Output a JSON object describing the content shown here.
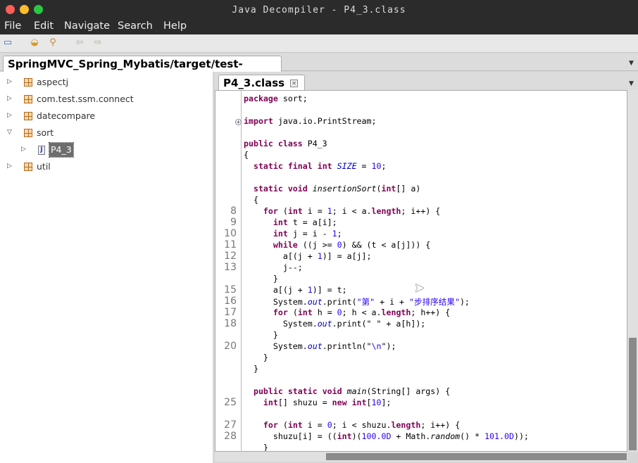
{
  "window": {
    "title": "Java Decompiler - P4_3.class"
  },
  "menu": [
    "File",
    "Edit",
    "Navigate",
    "Search",
    "Help"
  ],
  "toolbar": [
    {
      "icon": "open-file-icon"
    },
    {
      "icon": "open-type-icon"
    },
    {
      "icon": "search-icon"
    },
    {
      "icon": "back-arrow-icon"
    },
    {
      "icon": "forward-arrow-icon"
    }
  ],
  "outer_tab": {
    "label": "SpringMVC_Spring_Mybatis/target/test-classes"
  },
  "tree": [
    {
      "label": "aspectj",
      "expanded": false,
      "type": "package"
    },
    {
      "label": "com.test.ssm.connect",
      "expanded": false,
      "type": "package"
    },
    {
      "label": "datecompare",
      "expanded": false,
      "type": "package"
    },
    {
      "label": "sort",
      "expanded": true,
      "type": "package"
    },
    {
      "label": "P4_3",
      "expanded": false,
      "type": "class",
      "selected": true
    },
    {
      "label": "util",
      "expanded": false,
      "type": "package"
    }
  ],
  "editor_tab": {
    "label": "P4_3.class"
  },
  "colors": {
    "keyword": "#7f0055",
    "literal": "#2a00ff",
    "field": "#0000c0",
    "selection": "#6d6d6d"
  },
  "code": [
    {
      "n": "",
      "t": [
        [
          "k",
          "package"
        ],
        [
          "",
          "sort;"
        ]
      ]
    },
    {
      "n": "",
      "t": []
    },
    {
      "n": "",
      "fold": true,
      "t": [
        [
          "k",
          "import"
        ],
        [
          "",
          " java.io.PrintStream;"
        ]
      ]
    },
    {
      "n": "",
      "t": []
    },
    {
      "n": "",
      "t": [
        [
          "k",
          "public class"
        ],
        [
          "",
          " P4_3"
        ]
      ]
    },
    {
      "n": "",
      "t": [
        [
          "",
          "{"
        ]
      ]
    },
    {
      "n": "",
      "t": [
        [
          "",
          "  "
        ],
        [
          "k",
          "static final int"
        ],
        [
          "",
          " "
        ],
        [
          "f",
          "SIZE"
        ],
        [
          "",
          " = "
        ],
        [
          "n",
          "10"
        ],
        [
          "",
          ";"
        ]
      ]
    },
    {
      "n": "",
      "t": []
    },
    {
      "n": "",
      "t": [
        [
          "",
          "  "
        ],
        [
          "k",
          "static void"
        ],
        [
          "",
          " "
        ],
        [
          "i",
          "insertionSort"
        ],
        [
          "",
          "("
        ],
        [
          "k",
          "int"
        ],
        [
          "",
          "[] a)"
        ]
      ]
    },
    {
      "n": "",
      "t": [
        [
          "",
          "  {"
        ]
      ]
    },
    {
      "n": "8",
      "t": [
        [
          "",
          "    "
        ],
        [
          "k",
          "for"
        ],
        [
          "",
          " ("
        ],
        [
          "k",
          "int"
        ],
        [
          "",
          " i = "
        ],
        [
          "n",
          "1"
        ],
        [
          "",
          "; i < a."
        ],
        [
          "b",
          "length"
        ],
        [
          "",
          "; i++) {"
        ]
      ]
    },
    {
      "n": "9",
      "t": [
        [
          "",
          "      "
        ],
        [
          "k",
          "int"
        ],
        [
          "",
          " t = a[i];"
        ]
      ]
    },
    {
      "n": "10",
      "t": [
        [
          "",
          "      "
        ],
        [
          "k",
          "int"
        ],
        [
          "",
          " j = i - "
        ],
        [
          "n",
          "1"
        ],
        [
          "",
          ";"
        ]
      ]
    },
    {
      "n": "11",
      "t": [
        [
          "",
          "      "
        ],
        [
          "k",
          "while"
        ],
        [
          "",
          " ((j >= "
        ],
        [
          "n",
          "0"
        ],
        [
          "",
          ") && (t < a[j])) {"
        ]
      ]
    },
    {
      "n": "12",
      "t": [
        [
          "",
          "        a[(j + "
        ],
        [
          "n",
          "1"
        ],
        [
          "",
          ")] = a[j];"
        ]
      ]
    },
    {
      "n": "13",
      "t": [
        [
          "",
          "        j--;"
        ]
      ]
    },
    {
      "n": "",
      "t": [
        [
          "",
          "      }"
        ]
      ]
    },
    {
      "n": "15",
      "t": [
        [
          "",
          "      a[(j + "
        ],
        [
          "n",
          "1"
        ],
        [
          "",
          ")] = t;"
        ]
      ]
    },
    {
      "n": "16",
      "t": [
        [
          "",
          "      System."
        ],
        [
          "f",
          "out"
        ],
        [
          "",
          ".print("
        ],
        [
          "s",
          "\"第\""
        ],
        [
          "",
          " + i + "
        ],
        [
          "s",
          "\"步排序结果\""
        ],
        [
          "",
          ");"
        ]
      ]
    },
    {
      "n": "17",
      "t": [
        [
          "",
          "      "
        ],
        [
          "k",
          "for"
        ],
        [
          "",
          " ("
        ],
        [
          "k",
          "int"
        ],
        [
          "",
          " h = "
        ],
        [
          "n",
          "0"
        ],
        [
          "",
          "; h < a."
        ],
        [
          "b",
          "length"
        ],
        [
          "",
          "; h++) {"
        ]
      ]
    },
    {
      "n": "18",
      "t": [
        [
          "",
          "        System."
        ],
        [
          "f",
          "out"
        ],
        [
          "",
          ".print(\" \" + a[h]);"
        ]
      ]
    },
    {
      "n": "",
      "t": [
        [
          "",
          "      }"
        ]
      ]
    },
    {
      "n": "20",
      "t": [
        [
          "",
          "      System."
        ],
        [
          "f",
          "out"
        ],
        [
          "",
          ".println(\""
        ],
        [
          "s",
          "\\n"
        ],
        [
          "",
          "\");"
        ]
      ]
    },
    {
      "n": "",
      "t": [
        [
          "",
          "    }"
        ]
      ]
    },
    {
      "n": "",
      "t": [
        [
          "",
          "  }"
        ]
      ]
    },
    {
      "n": "",
      "t": []
    },
    {
      "n": "",
      "t": [
        [
          "",
          "  "
        ],
        [
          "k",
          "public static void"
        ],
        [
          "",
          " "
        ],
        [
          "i",
          "main"
        ],
        [
          "",
          "(String[] args) {"
        ]
      ]
    },
    {
      "n": "25",
      "t": [
        [
          "",
          "    "
        ],
        [
          "k",
          "int"
        ],
        [
          "",
          "[] shuzu = "
        ],
        [
          "k",
          "new int"
        ],
        [
          "",
          "["
        ],
        [
          "n",
          "10"
        ],
        [
          "",
          "];"
        ]
      ]
    },
    {
      "n": "",
      "t": []
    },
    {
      "n": "27",
      "t": [
        [
          "",
          "    "
        ],
        [
          "k",
          "for"
        ],
        [
          "",
          " ("
        ],
        [
          "k",
          "int"
        ],
        [
          "",
          " i = "
        ],
        [
          "n",
          "0"
        ],
        [
          "",
          "; i < shuzu."
        ],
        [
          "b",
          "length"
        ],
        [
          "",
          "; i++) {"
        ]
      ]
    },
    {
      "n": "28",
      "t": [
        [
          "",
          "      shuzu[i] = (("
        ],
        [
          "k",
          "int"
        ],
        [
          "",
          ")("
        ],
        [
          "n",
          "100.0D"
        ],
        [
          "",
          " + Math."
        ],
        [
          "i",
          "random"
        ],
        [
          "",
          "() * "
        ],
        [
          "n",
          "101.0D"
        ],
        [
          "",
          "));"
        ]
      ]
    },
    {
      "n": "",
      "t": [
        [
          "",
          "    }"
        ]
      ]
    }
  ]
}
